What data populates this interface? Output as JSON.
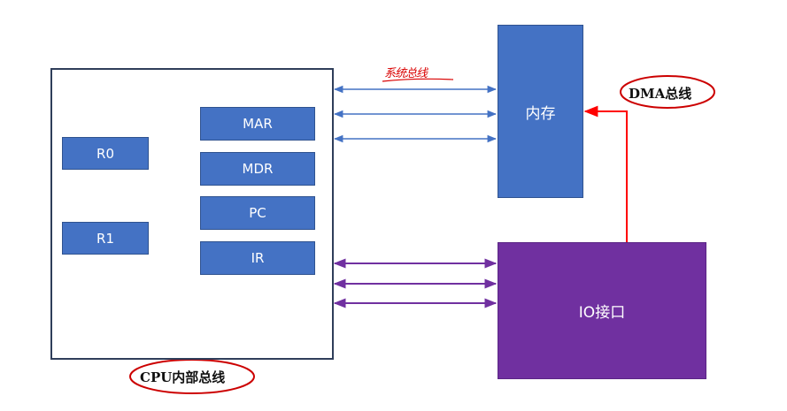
{
  "cpu": {
    "registers": {
      "mar": "MAR",
      "mdr": "MDR",
      "pc": "PC",
      "ir": "IR",
      "r0": "R0",
      "r1": "R1"
    },
    "internal_bus_label": "CPU内部总线"
  },
  "memory": {
    "label": "内存"
  },
  "io": {
    "label": "IO接口"
  },
  "annotations": {
    "system_bus_handwritten": "系统总线",
    "dma_bus": "DMA总线"
  },
  "colors": {
    "register_fill": "#4472c4",
    "io_fill": "#7030a0",
    "cpu_bus_line": "#4472c4",
    "memory_bus_arrows": "#4472c4",
    "io_bus_arrows": "#7030a0",
    "dma_arrow": "#ff0000",
    "annotation_circle": "#cc0000"
  }
}
